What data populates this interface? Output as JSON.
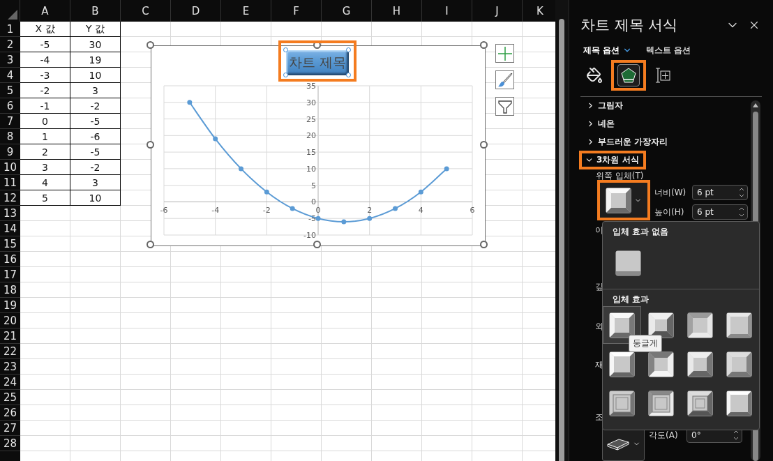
{
  "sheet": {
    "columns": [
      "A",
      "B",
      "C",
      "D",
      "E",
      "F",
      "G",
      "H",
      "I",
      "J",
      "K"
    ],
    "row_numbers": [
      "1",
      "2",
      "3",
      "4",
      "5",
      "6",
      "7",
      "8",
      "9",
      "10",
      "11",
      "12",
      "13",
      "14",
      "15",
      "16",
      "17",
      "18",
      "19",
      "20",
      "21",
      "22",
      "23",
      "24",
      "25",
      "26",
      "27",
      "28"
    ],
    "cells": [
      [
        "X 값",
        "Y 값"
      ],
      [
        "-5",
        "30"
      ],
      [
        "-4",
        "19"
      ],
      [
        "-3",
        "10"
      ],
      [
        "-2",
        "3"
      ],
      [
        "-1",
        "-2"
      ],
      [
        "0",
        "-5"
      ],
      [
        "1",
        "-6"
      ],
      [
        "2",
        "-5"
      ],
      [
        "3",
        "-2"
      ],
      [
        "4",
        "3"
      ],
      [
        "5",
        "10"
      ]
    ]
  },
  "chart": {
    "title": "차트 제목",
    "title_highlighted": true,
    "chart_data": {
      "type": "line",
      "grid": true,
      "x": [
        -5,
        -4,
        -3,
        -2,
        -1,
        0,
        1,
        2,
        3,
        4,
        5
      ],
      "series": [
        {
          "color": "#5b9bd5",
          "marker": "circle",
          "values": [
            30,
            19,
            10,
            3,
            -2,
            -5,
            -6,
            -5,
            -2,
            3,
            10
          ]
        }
      ],
      "xlim": [
        -6,
        6
      ],
      "ylim": [
        -10,
        35
      ],
      "xticks": [
        -6,
        -4,
        -2,
        0,
        2,
        4,
        6
      ],
      "yticks": [
        -10,
        -5,
        0,
        5,
        10,
        15,
        20,
        25,
        30,
        35
      ]
    },
    "tools": [
      {
        "kind": "elements"
      },
      {
        "kind": "styles"
      },
      {
        "kind": "filters"
      }
    ]
  },
  "panel": {
    "title": "차트 제목 서식",
    "tabs": [
      {
        "label": "제목 옵션",
        "selected": true
      },
      {
        "label": "텍스트 옵션",
        "selected": false
      }
    ],
    "icon_tabs": [
      {
        "kind": "fill",
        "selected": false,
        "highlighted": false
      },
      {
        "kind": "effects",
        "selected": true,
        "highlighted": true
      },
      {
        "kind": "size",
        "selected": false,
        "highlighted": false
      }
    ],
    "sections": [
      {
        "label": "그림자",
        "expanded": false,
        "highlighted": false
      },
      {
        "label": "네온",
        "expanded": false,
        "highlighted": false
      },
      {
        "label": "부드러운 가장자리",
        "expanded": false,
        "highlighted": false
      },
      {
        "label": "3차원 서식",
        "expanded": true,
        "highlighted": true
      }
    ],
    "bevel_label": "위쪽 입체(T)",
    "bevel_button_highlighted": true,
    "bevel_fields": [
      {
        "label": "너비(W)",
        "value": "6 pt"
      },
      {
        "label": "높이(H)",
        "value": "6 pt"
      }
    ],
    "covered_labels": [
      "이",
      "깊",
      "외",
      "재",
      "조"
    ],
    "angle_field": {
      "label": "각도(A)",
      "value": "0°"
    },
    "bevel_menu": {
      "none_heading": "입체 효과 없음",
      "effects_heading": "입체 효과",
      "effects": [
        {
          "selected": true
        },
        {
          "selected": false
        },
        {
          "selected": false
        },
        {
          "selected": false
        },
        {
          "selected": false
        },
        {
          "selected": false
        },
        {
          "selected": false
        },
        {
          "selected": false
        },
        {
          "selected": false
        },
        {
          "selected": false
        },
        {
          "selected": false
        },
        {
          "selected": false
        }
      ],
      "tooltip": "둥글게"
    }
  }
}
